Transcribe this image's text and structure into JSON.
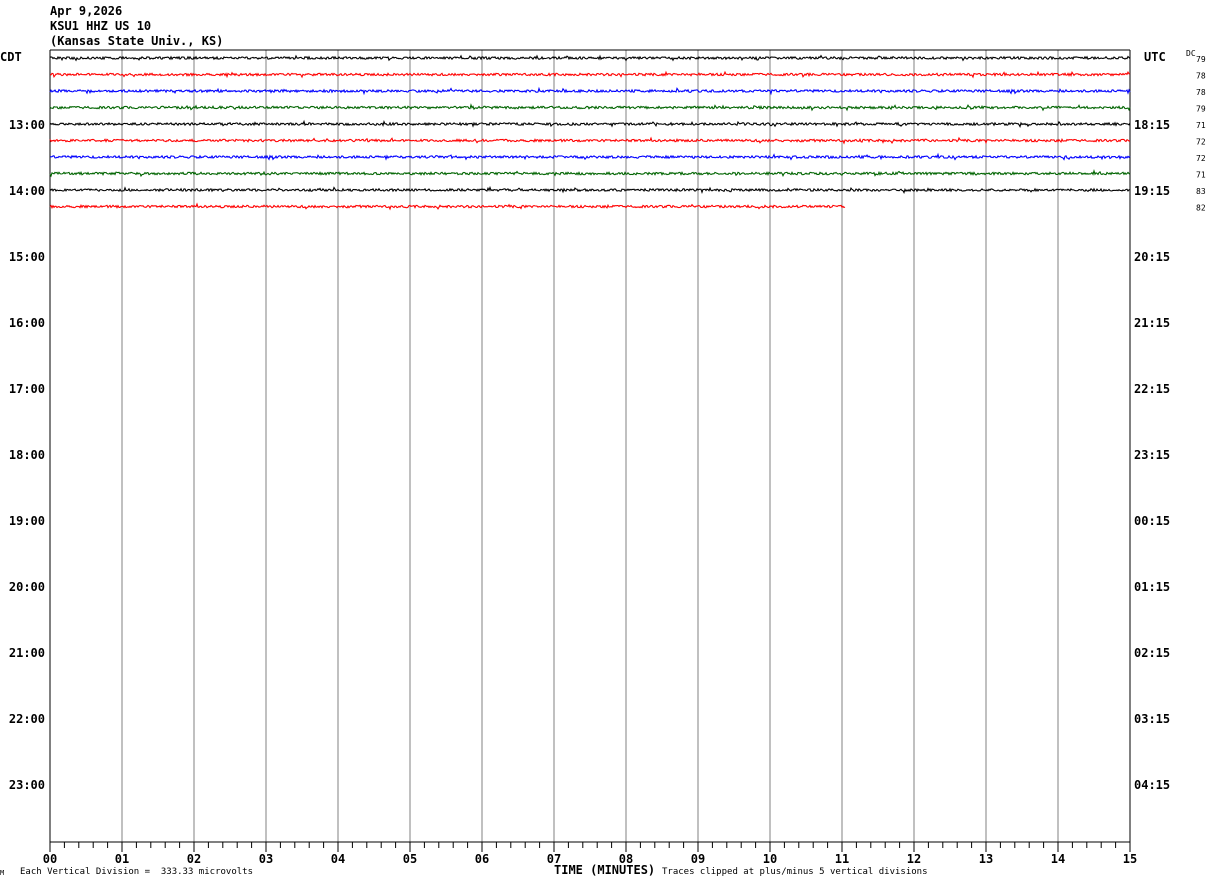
{
  "header": {
    "date": "Apr 9,2026",
    "station": "KSU1 HHZ US 10",
    "location": "(Kansas State Univ., KS)"
  },
  "left_tz": "CDT",
  "right_tz": "UTC",
  "dc_label": "DC",
  "footer": {
    "left_mark": "M",
    "scale_note": "Each Vertical Division =  333.33 microvolts",
    "axis_title": "TIME (MINUTES)",
    "clip_note": "Traces clipped at plus/minus 5 vertical divisions"
  },
  "colors": {
    "trace_cycle": [
      "#000000",
      "#ff0000",
      "#0000ff",
      "#006400"
    ],
    "grid": "#808080",
    "frame": "#000000"
  },
  "chart_data": {
    "type": "line",
    "title": "KSU1 HHZ US 10",
    "xlabel": "TIME (MINUTES)",
    "xlim": [
      0,
      15
    ],
    "x_ticks": [
      "00",
      "01",
      "02",
      "03",
      "04",
      "05",
      "06",
      "07",
      "08",
      "09",
      "10",
      "11",
      "12",
      "13",
      "14",
      "15"
    ],
    "rows_total": 48,
    "left_hour_labels": [
      "13:00",
      "14:00",
      "15:00",
      "16:00",
      "17:00",
      "18:00",
      "19:00",
      "20:00",
      "21:00",
      "22:00",
      "23:00"
    ],
    "right_hour_labels": [
      "18:15",
      "19:15",
      "20:15",
      "21:15",
      "22:15",
      "23:15",
      "00:15",
      "01:15",
      "02:15",
      "03:15",
      "04:15"
    ],
    "traces": [
      {
        "row": 0,
        "color": "#000000",
        "end_minute": 15,
        "dc": "79"
      },
      {
        "row": 1,
        "color": "#ff0000",
        "end_minute": 15,
        "dc": "78"
      },
      {
        "row": 2,
        "color": "#0000ff",
        "end_minute": 15,
        "dc": "78"
      },
      {
        "row": 3,
        "color": "#006400",
        "end_minute": 15,
        "dc": "79"
      },
      {
        "row": 4,
        "color": "#000000",
        "end_minute": 15,
        "dc": "71"
      },
      {
        "row": 5,
        "color": "#ff0000",
        "end_minute": 15,
        "dc": "72"
      },
      {
        "row": 6,
        "color": "#0000ff",
        "end_minute": 15,
        "dc": "72"
      },
      {
        "row": 7,
        "color": "#006400",
        "end_minute": 15,
        "dc": "71"
      },
      {
        "row": 8,
        "color": "#000000",
        "end_minute": 15,
        "dc": "83"
      },
      {
        "row": 9,
        "color": "#ff0000",
        "end_minute": 11.05,
        "dc": "82"
      }
    ]
  }
}
